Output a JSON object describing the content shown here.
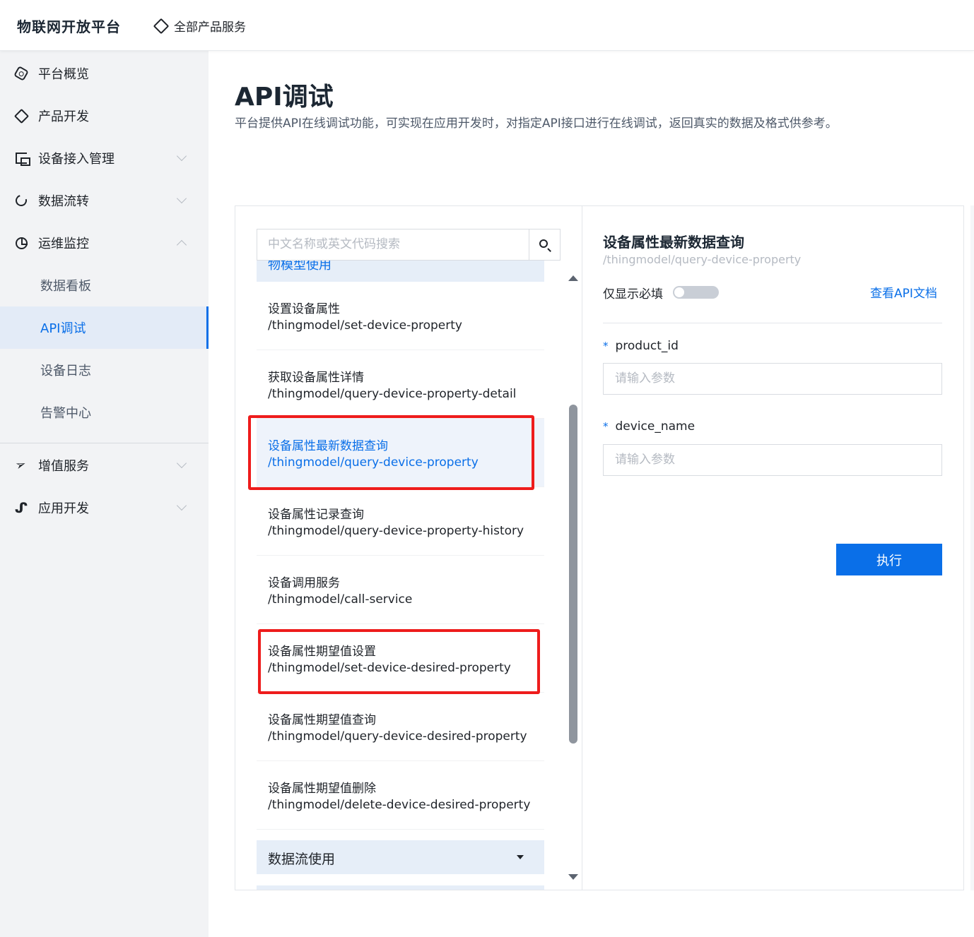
{
  "header": {
    "brand": "物联网开放平台",
    "all_products": "全部产品服务"
  },
  "sidebar": {
    "items": [
      {
        "label": "平台概览",
        "icon": "overview-icon"
      },
      {
        "label": "产品开发",
        "icon": "cube-icon"
      },
      {
        "label": "设备接入管理",
        "icon": "device-icon",
        "expandable": true
      },
      {
        "label": "数据流转",
        "icon": "flow-icon",
        "expandable": true
      },
      {
        "label": "运维监控",
        "icon": "monitor-icon",
        "expanded": true
      },
      {
        "label": "数据看板"
      },
      {
        "label": "API调试",
        "active": true
      },
      {
        "label": "设备日志"
      },
      {
        "label": "告警中心"
      },
      {
        "label": "增值服务",
        "icon": "plane-icon",
        "expandable": true
      },
      {
        "label": "应用开发",
        "icon": "app-icon",
        "expandable": true
      }
    ]
  },
  "page": {
    "title": "API调试",
    "description": "平台提供API在线调试功能，可实现在应用开发时，对指定API接口进行在线调试，返回真实的数据及格式供参考。"
  },
  "api_list": {
    "search_placeholder": "中文名称或英文代码搜索",
    "partial_group_label": "物模型使用",
    "items": [
      {
        "name": "设置设备属性",
        "path": "/thingmodel/set-device-property"
      },
      {
        "name": "获取设备属性详情",
        "path": "/thingmodel/query-device-property-detail"
      },
      {
        "name": "设备属性最新数据查询",
        "path": "/thingmodel/query-device-property",
        "active": true
      },
      {
        "name": "设备属性记录查询",
        "path": "/thingmodel/query-device-property-history"
      },
      {
        "name": "设备调用服务",
        "path": "/thingmodel/call-service"
      },
      {
        "name": "设备属性期望值设置",
        "path": "/thingmodel/set-device-desired-property"
      },
      {
        "name": "设备属性期望值查询",
        "path": "/thingmodel/query-device-desired-property"
      },
      {
        "name": "设备属性期望值删除",
        "path": "/thingmodel/delete-device-desired-property"
      }
    ],
    "next_group_label": "数据流使用"
  },
  "detail": {
    "title": "设备属性最新数据查询",
    "path": "/thingmodel/query-device-property",
    "required_only_label": "仅显示必填",
    "required_only": false,
    "doc_link": "查看API文档",
    "fields": [
      {
        "name": "product_id",
        "placeholder": "请输入参数",
        "required_mark": "*"
      },
      {
        "name": "device_name",
        "placeholder": "请输入参数",
        "required_mark": "*"
      }
    ],
    "execute_label": "执行"
  },
  "colors": {
    "accent": "#0a6fe8",
    "highlight_box": "#ee1c1c"
  }
}
